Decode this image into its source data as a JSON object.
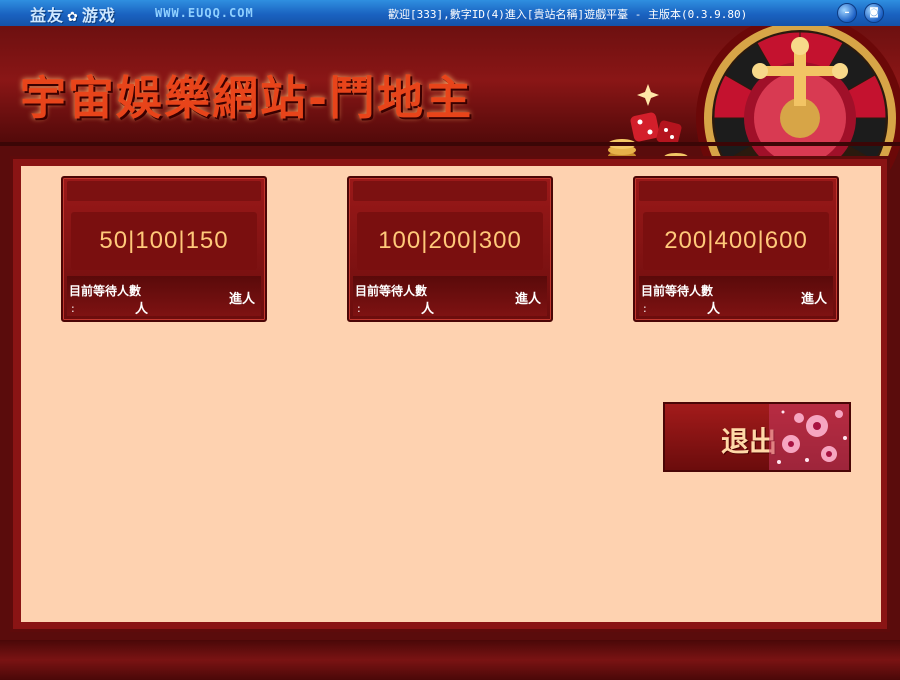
{
  "titlebar": {
    "brand_left": "益友",
    "brand_right": "游戏",
    "site": "WWW.EUQQ.COM",
    "window_title": "歡迎[333],數字ID(4)進入[貴站名稱]遊戲平臺 - 主版本(0.3.9.80)",
    "icons": [
      "minimize-icon",
      "close-icon"
    ]
  },
  "header": {
    "logo_text": "宇宙娛樂網站-鬥地主"
  },
  "rooms": [
    {
      "stakes": "50|100|150",
      "wait_label": "目前等待人數",
      "colon": ":",
      "wait_unit": "人",
      "enter_label": "進人"
    },
    {
      "stakes": "100|200|300",
      "wait_label": "目前等待人數",
      "colon": ":",
      "wait_unit": "人",
      "enter_label": "進人"
    },
    {
      "stakes": "200|400|600",
      "wait_label": "目前等待人數",
      "colon": ":",
      "wait_unit": "人",
      "enter_label": "進人"
    }
  ],
  "exit_button": {
    "label": "退出"
  },
  "colors": {
    "accent": "#8a1414",
    "panel_bg": "#fed2b0",
    "gold_text": "#ffc97a",
    "titlebar": "#1a62c0"
  }
}
